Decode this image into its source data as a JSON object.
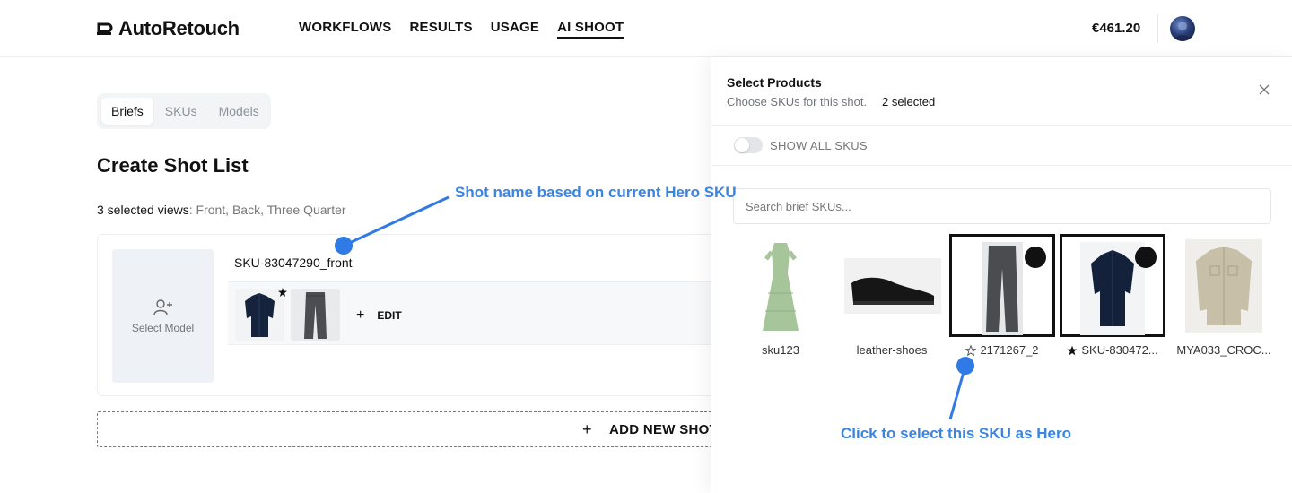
{
  "header": {
    "brand": "AutoRetouch",
    "nav": [
      {
        "label": "WORKFLOWS",
        "active": false
      },
      {
        "label": "RESULTS",
        "active": false
      },
      {
        "label": "USAGE",
        "active": false
      },
      {
        "label": "AI SHOOT",
        "active": true
      }
    ],
    "balance": "€461.20",
    "avatar_icon": "user-avatar"
  },
  "main": {
    "tabs": [
      {
        "label": "Briefs",
        "active": true
      },
      {
        "label": "SKUs",
        "active": false
      },
      {
        "label": "Models",
        "active": false
      }
    ],
    "title": "Create Shot List",
    "views_count": "3 selected views",
    "views_list": ": Front, Back, Three Quarter",
    "shot": {
      "model_label": "Select Model",
      "name": "SKU-83047290_front",
      "edit_label": "EDIT",
      "edit_plus": "+"
    },
    "add_shot": {
      "plus": "+",
      "label": "ADD NEW SHOT"
    }
  },
  "panel": {
    "title": "Select Products",
    "subtitle": "Choose SKUs for this shot.",
    "count": "2 selected",
    "toggle_label": "SHOW ALL SKUS",
    "toggle_on": false,
    "search_placeholder": "Search brief SKUs...",
    "skus": [
      {
        "label": "sku123",
        "selected": false,
        "hero": null,
        "image": "green-dress"
      },
      {
        "label": "leather-shoes",
        "selected": false,
        "hero": null,
        "image": "black-shoe"
      },
      {
        "label": "2171267_2",
        "selected": true,
        "hero": "outline",
        "image": "grey-jeans"
      },
      {
        "label": "SKU-830472...",
        "selected": true,
        "hero": "filled",
        "image": "navy-shirt"
      },
      {
        "label": "MYA033_CROC...",
        "selected": false,
        "hero": null,
        "image": "beige-jacket"
      }
    ]
  },
  "annotations": {
    "top": "Shot name based on current Hero SKU",
    "bottom": "Click to select this SKU as Hero"
  },
  "colors": {
    "annotation": "#3b84df",
    "annotation_dot": "#2f7ae5",
    "selected_border": "#111111"
  }
}
